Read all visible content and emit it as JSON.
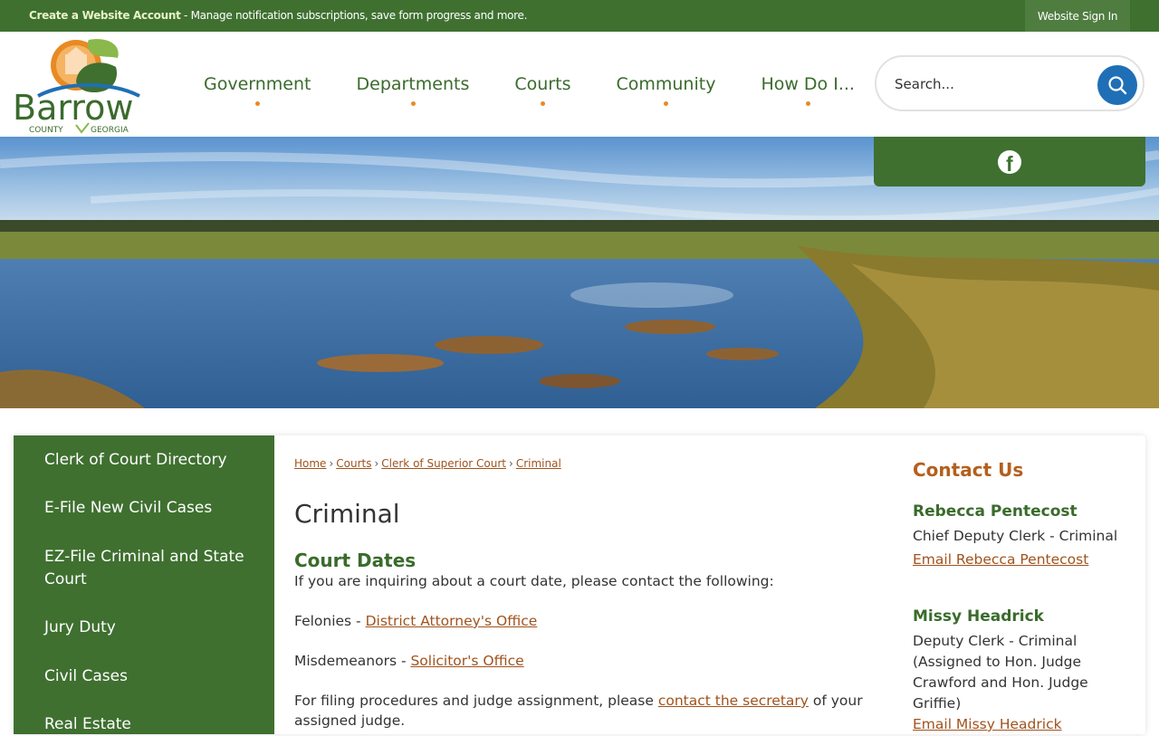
{
  "topbar": {
    "create_account": "Create a Website Account",
    "message": " - Manage notification subscriptions, save form progress and more.",
    "sign_in": "Website Sign In"
  },
  "logo": {
    "name": "Barrow",
    "sub_left": "COUNTY",
    "sub_right": "GEORGIA"
  },
  "nav": {
    "items": [
      {
        "label": "Government"
      },
      {
        "label": "Departments"
      },
      {
        "label": "Courts"
      },
      {
        "label": "Community"
      },
      {
        "label": "How Do I..."
      }
    ]
  },
  "search": {
    "placeholder": "Search...",
    "icon": "search-icon"
  },
  "social": {
    "icon": "facebook-icon"
  },
  "sidebar": {
    "items": [
      {
        "label": "Clerk of Court Directory"
      },
      {
        "label": "E-File New Civil Cases"
      },
      {
        "label": "EZ-File Criminal and State Court"
      },
      {
        "label": "Jury Duty"
      },
      {
        "label": "Civil Cases"
      },
      {
        "label": "Real Estate"
      }
    ]
  },
  "breadcrumb": {
    "items": [
      {
        "label": "Home"
      },
      {
        "label": "Courts"
      },
      {
        "label": "Clerk of Superior Court"
      },
      {
        "label": "Criminal"
      }
    ],
    "separator": "›"
  },
  "main": {
    "title": "Criminal",
    "section_title": "Court Dates",
    "intro": "If you are inquiring about a court date, please contact the following:",
    "felonies_label": "Felonies - ",
    "felonies_link": "District Attorney's Office",
    "misdemeanors_label": "Misdemeanors - ",
    "misdemeanors_link": "Solicitor's Office",
    "filing_text": "For filing procedures and judge assignment, please ",
    "filing_link": "contact the secretary",
    "filing_text_end": " of your",
    "filing_text_cont": "assigned judge."
  },
  "contact": {
    "heading": "Contact Us",
    "people": [
      {
        "name": "Rebecca Pentecost",
        "role": "Chief Deputy Clerk - Criminal",
        "email_link": "Email Rebecca Pentecost"
      },
      {
        "name": "Missy Headrick",
        "role": "Deputy Clerk - Criminal (Assigned to Hon. Judge Crawford and Hon. Judge Griffie)",
        "email_link": "Email Missy Headrick"
      }
    ]
  },
  "colors": {
    "brand_green": "#3f7030",
    "accent_orange": "#e88a24",
    "link_brown": "#a0531d",
    "search_blue": "#1f6fb6"
  }
}
